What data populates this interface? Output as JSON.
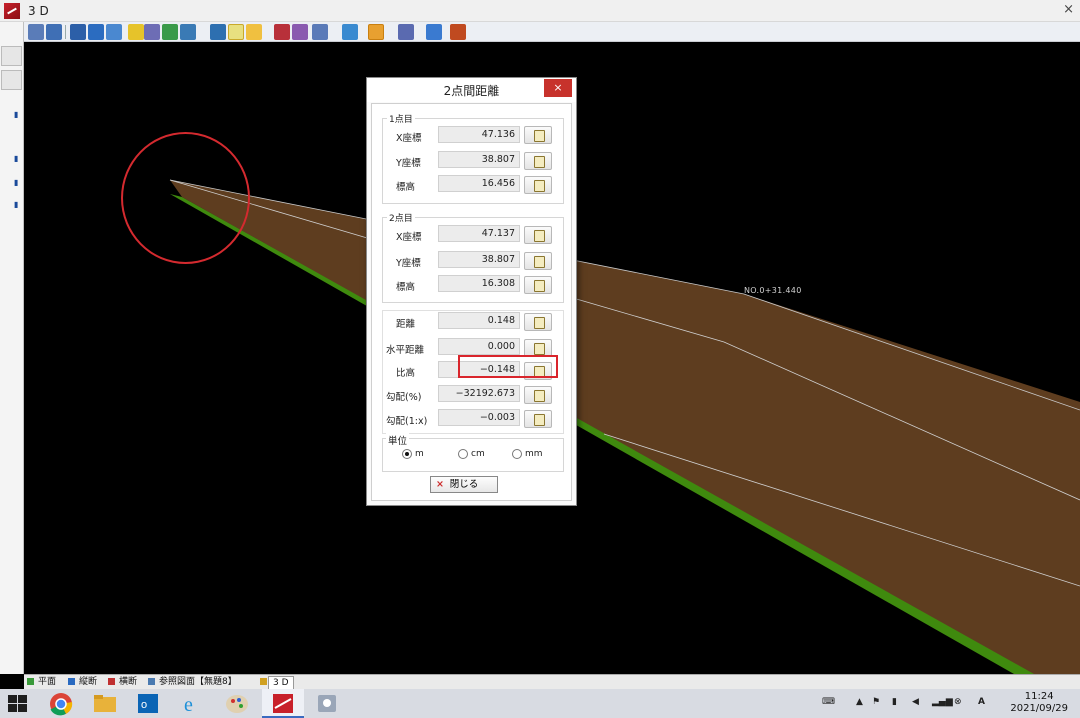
{
  "window": {
    "title": "3 D"
  },
  "viewport": {
    "station_label": "NO.0+31.440"
  },
  "dialog": {
    "title": "2点間距離",
    "close_symbol": "×",
    "point1": {
      "title": "1点目",
      "x_label": "X座標",
      "x_value": "47.136",
      "y_label": "Y座標",
      "y_value": "38.807",
      "z_label": "標高",
      "z_value": "16.456"
    },
    "point2": {
      "title": "2点目",
      "x_label": "X座標",
      "x_value": "47.137",
      "y_label": "Y座標",
      "y_value": "38.807",
      "z_label": "標高",
      "z_value": "16.308"
    },
    "results": {
      "distance_label": "距離",
      "distance_value": "0.148",
      "horizontal_label": "水平距離",
      "horizontal_value": "0.000",
      "height_diff_label": "比高",
      "height_diff_value": "−0.148",
      "grade_pct_label": "勾配(%)",
      "grade_pct_value": "−32192.673",
      "grade_ratio_label": "勾配(1:x)",
      "grade_ratio_value": "−0.003"
    },
    "unit": {
      "title": "単位",
      "options": [
        "m",
        "cm",
        "mm"
      ],
      "selected": "m"
    },
    "close_button": "閉じる"
  },
  "tabs": [
    "平面",
    "縦断",
    "横断",
    "参照図面【無題8】",
    "3 D"
  ],
  "taskbar": {
    "time": "11:24",
    "date": "2021/09/29"
  },
  "colors": {
    "surface_brown": "#5e3d1f",
    "slope_green": "#3f8a0e",
    "annotation_red": "#d42a2f"
  }
}
